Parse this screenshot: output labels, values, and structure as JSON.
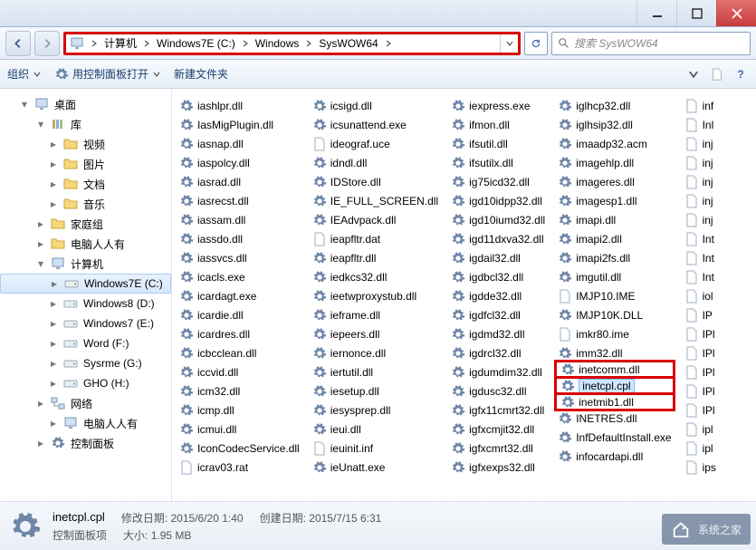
{
  "window": {
    "title": ""
  },
  "address": {
    "crumbs": [
      "计算机",
      "Windows7E (C:)",
      "Windows",
      "SysWOW64"
    ],
    "refresh_tip": "刷新"
  },
  "search": {
    "placeholder": "搜索 SysWOW64"
  },
  "toolbar": {
    "organize": "组织",
    "open_with": "用控制面板打开",
    "new_folder": "新建文件夹"
  },
  "nav": {
    "desktop": "桌面",
    "libraries": "库",
    "videos": "视频",
    "pictures": "图片",
    "documents": "文档",
    "music": "音乐",
    "homegroup": "家庭组",
    "user": "电脑人人有",
    "computer": "计算机",
    "drive_c": "Windows7E (C:)",
    "drive_d": "Windows8 (D:)",
    "drive_e": "Windows7 (E:)",
    "drive_f": "Word (F:)",
    "drive_g": "Sysrme (G:)",
    "drive_h": "GHO (H:)",
    "network": "网络",
    "user2": "电脑人人有",
    "control_panel": "控制面板"
  },
  "columns": [
    [
      "iashlpr.dll",
      "IasMigPlugin.dll",
      "iasnap.dll",
      "iaspolcy.dll",
      "iasrad.dll",
      "iasrecst.dll",
      "iassam.dll",
      "iassdo.dll",
      "iassvcs.dll",
      "icacls.exe",
      "icardagt.exe",
      "icardie.dll",
      "icardres.dll",
      "icbcclean.dll",
      "iccvid.dll",
      "icm32.dll",
      "icmp.dll",
      "icmui.dll",
      "IconCodecService.dll",
      "icrav03.rat"
    ],
    [
      "icsigd.dll",
      "icsunattend.exe",
      "ideograf.uce",
      "idndl.dll",
      "IDStore.dll",
      "IE_FULL_SCREEN.dll",
      "IEAdvpack.dll",
      "ieapfltr.dat",
      "ieapfltr.dll",
      "iedkcs32.dll",
      "ieetwproxystub.dll",
      "ieframe.dll",
      "iepeers.dll",
      "iernonce.dll",
      "iertutil.dll",
      "iesetup.dll",
      "iesysprep.dll",
      "ieui.dll",
      "ieuinit.inf",
      "ieUnatt.exe"
    ],
    [
      "iexpress.exe",
      "ifmon.dll",
      "ifsutil.dll",
      "ifsutilx.dll",
      "ig75icd32.dll",
      "igd10idpp32.dll",
      "igd10iumd32.dll",
      "igd11dxva32.dll",
      "igdail32.dll",
      "igdbcl32.dll",
      "igdde32.dll",
      "igdfcl32.dll",
      "igdmd32.dll",
      "igdrcl32.dll",
      "igdumdim32.dll",
      "igdusc32.dll",
      "igfx11cmrt32.dll",
      "igfxcmjit32.dll",
      "igfxcmrt32.dll",
      "igfxexps32.dll"
    ],
    [
      "iglhcp32.dll",
      "iglhsip32.dll",
      "imaadp32.acm",
      "imagehlp.dll",
      "imageres.dll",
      "imagesp1.dll",
      "imapi.dll",
      "imapi2.dll",
      "imapi2fs.dll",
      "imgutil.dll",
      "IMJP10.IME",
      "IMJP10K.DLL",
      "imkr80.ime",
      "imm32.dll",
      "inetcomm.dll",
      "inetcpl.cpl",
      "inetmib1.dll",
      "INETRES.dll",
      "InfDefaultInstall.exe",
      "infocardapi.dll"
    ],
    [
      "inf",
      "Inl",
      "inj",
      "inj",
      "inj",
      "inj",
      "inj",
      "Int",
      "Int",
      "Int",
      "iol",
      "IP",
      "IPl",
      "IPl",
      "IPl",
      "IPl",
      "IPl",
      "ipl",
      "ipl",
      "ips"
    ]
  ],
  "selected_item": "inetcpl.cpl",
  "highlighted_items": [
    "inetcomm.dll",
    "inetcpl.cpl",
    "inetmib1.dll"
  ],
  "details": {
    "name": "inetcpl.cpl",
    "type": "控制面板项",
    "mod_label": "修改日期:",
    "mod_value": "2015/6/20 1:40",
    "create_label": "创建日期:",
    "create_value": "2015/7/15 6:31",
    "size_label": "大小:",
    "size_value": "1.95 MB"
  },
  "watermark": "系统之家"
}
